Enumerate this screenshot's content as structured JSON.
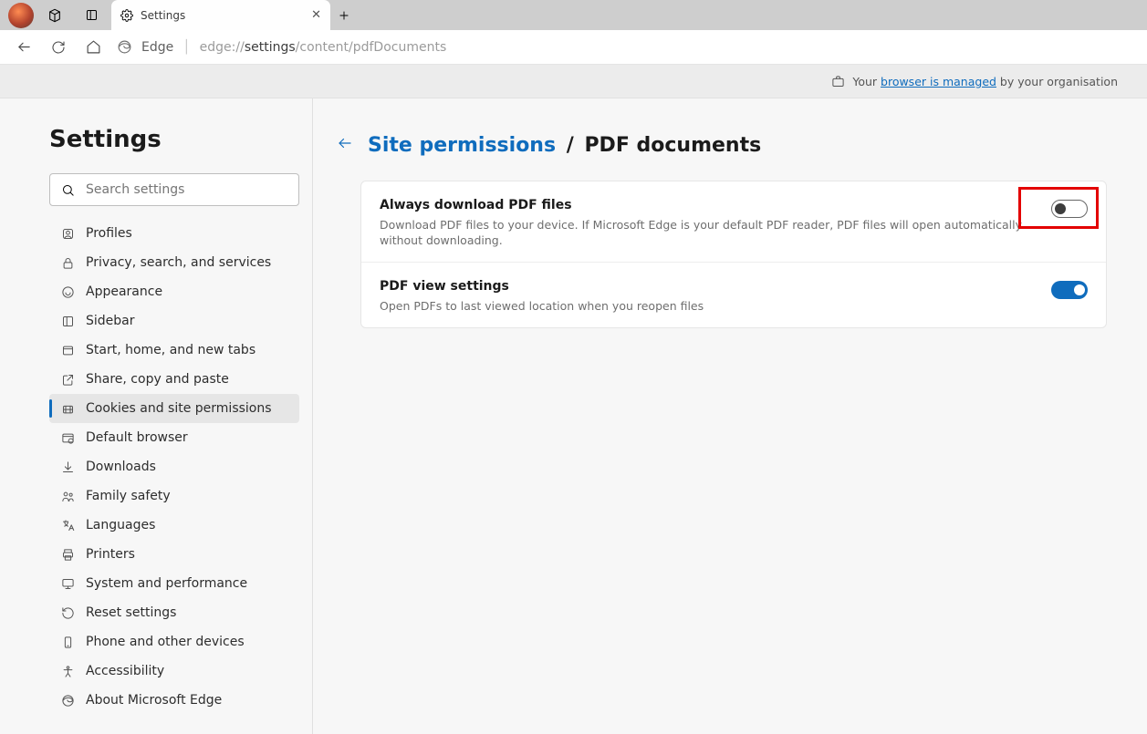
{
  "tab": {
    "title": "Settings"
  },
  "addressbar": {
    "brand": "Edge",
    "url_prefix": "edge://",
    "url_bold": "settings",
    "url_suffix": "/content/pdfDocuments"
  },
  "banner": {
    "prefix": "Your ",
    "link": "browser is managed",
    "suffix": " by your organisation"
  },
  "sidebar": {
    "title": "Settings",
    "search_placeholder": "Search settings",
    "items": [
      {
        "label": "Profiles",
        "icon": "profile-icon"
      },
      {
        "label": "Privacy, search, and services",
        "icon": "lock-icon"
      },
      {
        "label": "Appearance",
        "icon": "appearance-icon"
      },
      {
        "label": "Sidebar",
        "icon": "sidebar-icon"
      },
      {
        "label": "Start, home, and new tabs",
        "icon": "home-tab-icon"
      },
      {
        "label": "Share, copy and paste",
        "icon": "share-icon"
      },
      {
        "label": "Cookies and site permissions",
        "icon": "cookies-icon",
        "active": true
      },
      {
        "label": "Default browser",
        "icon": "browser-icon"
      },
      {
        "label": "Downloads",
        "icon": "download-icon"
      },
      {
        "label": "Family safety",
        "icon": "family-icon"
      },
      {
        "label": "Languages",
        "icon": "language-icon"
      },
      {
        "label": "Printers",
        "icon": "printer-icon"
      },
      {
        "label": "System and performance",
        "icon": "system-icon"
      },
      {
        "label": "Reset settings",
        "icon": "reset-icon"
      },
      {
        "label": "Phone and other devices",
        "icon": "phone-icon"
      },
      {
        "label": "Accessibility",
        "icon": "accessibility-icon"
      },
      {
        "label": "About Microsoft Edge",
        "icon": "edge-logo-icon"
      }
    ]
  },
  "breadcrumb": {
    "parent": "Site permissions",
    "current": "PDF documents"
  },
  "settings": [
    {
      "title": "Always download PDF files",
      "desc": "Download PDF files to your device. If Microsoft Edge is your default PDF reader, PDF files will open automatically without downloading.",
      "on": false,
      "highlight": true
    },
    {
      "title": "PDF view settings",
      "desc": "Open PDFs to last viewed location when you reopen files",
      "on": true,
      "highlight": false
    }
  ]
}
